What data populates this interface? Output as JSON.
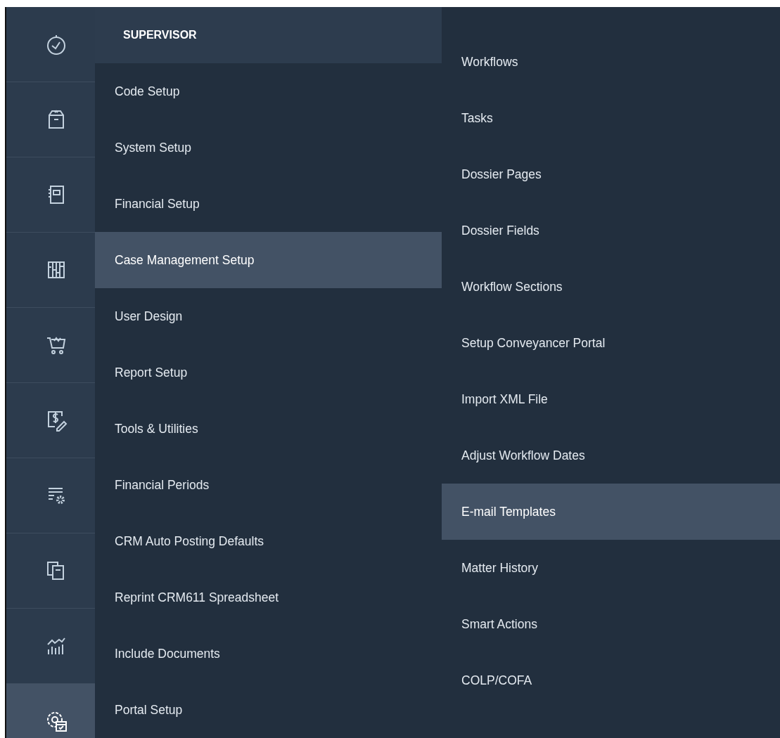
{
  "icon_rail": [
    {
      "kind": "stopwatch",
      "selected": false
    },
    {
      "kind": "box",
      "selected": false
    },
    {
      "kind": "notebook",
      "selected": false
    },
    {
      "kind": "binders",
      "selected": false
    },
    {
      "kind": "cart",
      "selected": false
    },
    {
      "kind": "invoice",
      "selected": false
    },
    {
      "kind": "list-settings",
      "selected": false
    },
    {
      "kind": "documents",
      "selected": false
    },
    {
      "kind": "chart",
      "selected": false
    },
    {
      "kind": "settings-calendar",
      "selected": true
    }
  ],
  "menu": {
    "header": "SUPERVISOR",
    "items": [
      {
        "label": "Code Setup",
        "selected": false
      },
      {
        "label": "System Setup",
        "selected": false
      },
      {
        "label": "Financial Setup",
        "selected": false
      },
      {
        "label": "Case Management Setup",
        "selected": true
      },
      {
        "label": "User Design",
        "selected": false
      },
      {
        "label": "Report Setup",
        "selected": false
      },
      {
        "label": "Tools & Utilities",
        "selected": false
      },
      {
        "label": "Financial Periods",
        "selected": false
      },
      {
        "label": "CRM Auto Posting Defaults",
        "selected": false
      },
      {
        "label": "Reprint CRM611 Spreadsheet",
        "selected": false
      },
      {
        "label": "Include Documents",
        "selected": false
      },
      {
        "label": "Portal Setup",
        "selected": false
      }
    ]
  },
  "submenu": {
    "items": [
      {
        "label": "Workflows",
        "selected": false
      },
      {
        "label": "Tasks",
        "selected": false
      },
      {
        "label": "Dossier Pages",
        "selected": false
      },
      {
        "label": "Dossier Fields",
        "selected": false
      },
      {
        "label": "Workflow Sections",
        "selected": false
      },
      {
        "label": "Setup Conveyancer Portal",
        "selected": false
      },
      {
        "label": "Import XML File",
        "selected": false
      },
      {
        "label": "Adjust Workflow Dates",
        "selected": false
      },
      {
        "label": "E-mail Templates",
        "selected": true
      },
      {
        "label": "Matter History",
        "selected": false
      },
      {
        "label": "Smart Actions",
        "selected": false
      },
      {
        "label": "COLP/COFA",
        "selected": false
      }
    ]
  }
}
